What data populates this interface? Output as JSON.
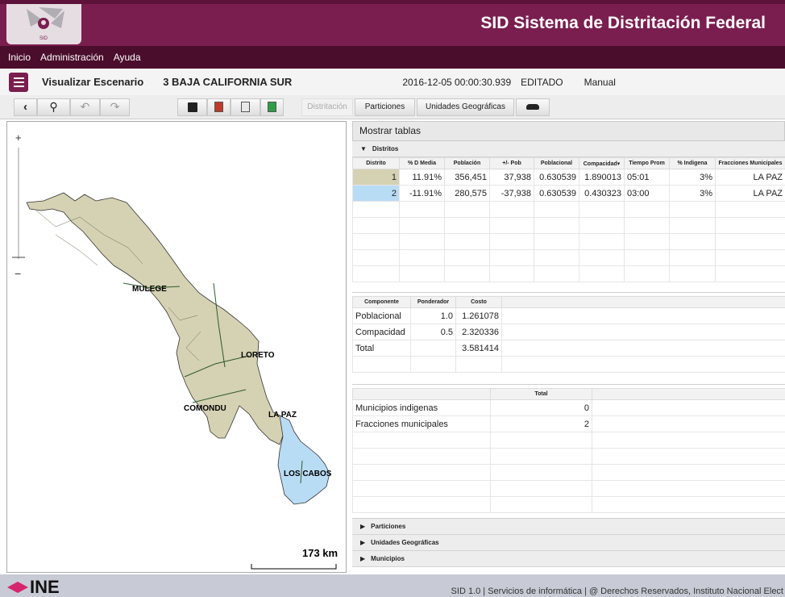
{
  "header": {
    "title": "SID Sistema de Distritación Federal",
    "logo_text": "SID"
  },
  "menu": [
    "Inicio",
    "Administración",
    "Ayuda"
  ],
  "scenario": {
    "label": "Visualizar Escenario",
    "name": "3 BAJA CALIFORNIA SUR",
    "timestamp": "2016-12-05 00:00:30.939",
    "status": "EDITADO",
    "mode": "Manual"
  },
  "toolbar": {
    "distritacion": "Distritación",
    "particiones": "Particiones",
    "unidades": "Unidades Geográficas"
  },
  "map": {
    "zoom_plus": "+",
    "zoom_minus": "−",
    "scale": "173 km",
    "labels": {
      "mulege": "MULEGE",
      "loreto": "LORETO",
      "comondu": "COMONDU",
      "lapaz": "LA PAZ",
      "loscabos": "LOS CABOS"
    }
  },
  "panel": {
    "title": "Mostrar tablas",
    "distritos": {
      "label": "Distritos",
      "headers": [
        "Distrito",
        "% D Media",
        "Población",
        "+/- Pob",
        "Poblacional",
        "Compacidad▾",
        "Tiempo Prom",
        "% Indigena",
        "Fracciones Municipales"
      ],
      "rows": [
        [
          "1",
          "11.91%",
          "356,451",
          "37,938",
          "0.630539",
          "1.890013",
          "05:01",
          "3%",
          "LA PAZ"
        ],
        [
          "2",
          "-11.91%",
          "280,575",
          "-37,938",
          "0.630539",
          "0.430323",
          "03:00",
          "3%",
          "LA PAZ"
        ]
      ],
      "colors": [
        "#d5d1b3",
        "#b9dcf5"
      ]
    },
    "costo": {
      "headers": [
        "Componente",
        "Ponderador",
        "Costo"
      ],
      "rows": [
        [
          "Poblacional",
          "1.0",
          "1.261078"
        ],
        [
          "Compacidad",
          "0.5",
          "2.320336"
        ],
        [
          "Total",
          "",
          "3.581414"
        ]
      ]
    },
    "totales": {
      "header": "Total",
      "rows": [
        [
          "Municipios indigenas",
          "0"
        ],
        [
          "Fracciones municipales",
          "2"
        ]
      ]
    },
    "sections": [
      "Particiones",
      "Unidades Geográficas",
      "Municipios"
    ]
  },
  "footer": {
    "brand": "INE",
    "text": "SID 1.0 | Servicios de informática | @ Derechos Reservados, Instituto Nacional Elect"
  }
}
